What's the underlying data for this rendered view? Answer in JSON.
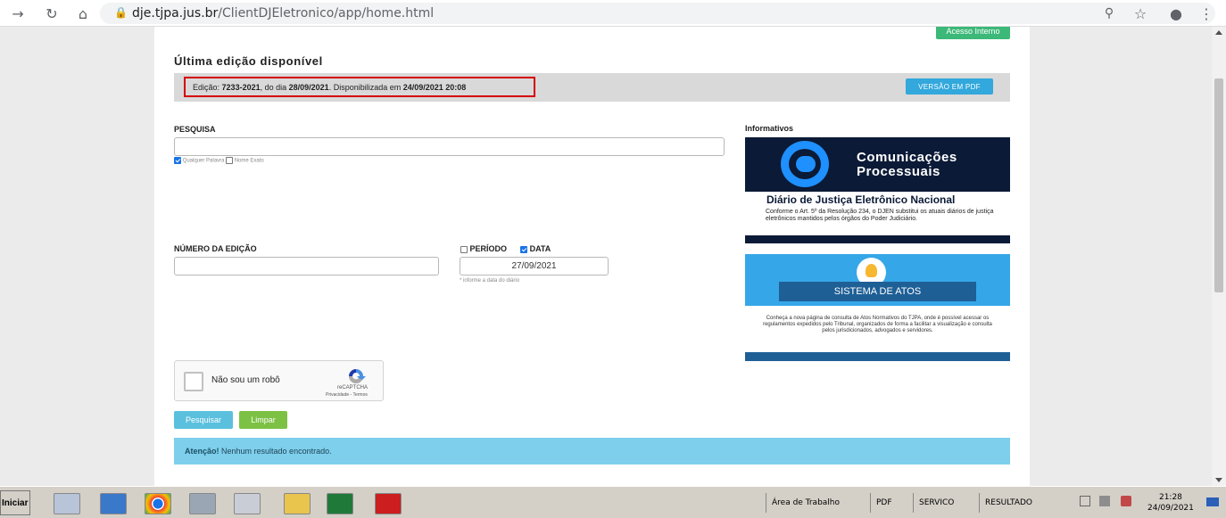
{
  "browser": {
    "url_host": "dje.tjpa.jus.br",
    "url_path": "/ClientDJEletronico/app/home.html"
  },
  "header": {
    "acesso_interno": "Acesso Interno",
    "ultima_edicao_title": "Última edição disponível",
    "edicao_prefix": "Edição:",
    "edicao_numero": "7233-2021",
    "edicao_dia_prefix": ", do dia",
    "edicao_dia": "28/09/2021",
    "edicao_disp_prefix": ". Disponibilizada em",
    "edicao_disp": "24/09/2021 20:08",
    "versao_pdf": "VERSÃO EM PDF"
  },
  "search": {
    "pesquisa_label": "PESQUISA",
    "pesquisa_value": "",
    "opt_qualquer": "Qualquer Palavra",
    "opt_qualquer_checked": true,
    "opt_nome": "Nome Exato",
    "opt_nome_checked": false,
    "numero_label": "NÚMERO DA EDIÇÃO",
    "numero_value": "",
    "periodo_label": "PERÍODO",
    "periodo_checked": false,
    "data_label": "DATA",
    "data_checked": true,
    "data_value": "27/09/2021",
    "data_hint": "* informe a data do diário",
    "captcha_text": "Não sou um robô",
    "captcha_brand": "reCAPTCHA",
    "captcha_terms": "Privacidade - Termos",
    "btn_pesquisar": "Pesquisar",
    "btn_limpar": "Limpar"
  },
  "alert": {
    "strong": "Atenção!",
    "text": " Nenhum resultado encontrado."
  },
  "informativos": {
    "title": "Informativos",
    "banner1": {
      "line1": "Comunicações",
      "line2": "Processuais",
      "heading": "Diário de Justiça Eletrônico Nacional",
      "text": "Conforme o Art. 5º da Resolução 234, o DJEN substitui os atuais diários de justiça eletrônicos mantidos pelos órgãos do Poder Judiciário."
    },
    "banner2": {
      "ribbon": "SISTEMA DE ATOS",
      "text": "Conheça a nova página de consulta de Atos Normativos do TJPA, onde é possível acessar os regulamentos expedidos pelo Tribunal, organizados de forma a facilitar a visualização e consulta pelos jurisdicionados, advogados e servidores."
    }
  },
  "taskbar": {
    "start": "Iniciar",
    "items": [
      "Área de Trabalho",
      "PDF",
      "SERVICO",
      "RESULTADO"
    ],
    "time": "21:28",
    "date": "24/09/2021"
  }
}
